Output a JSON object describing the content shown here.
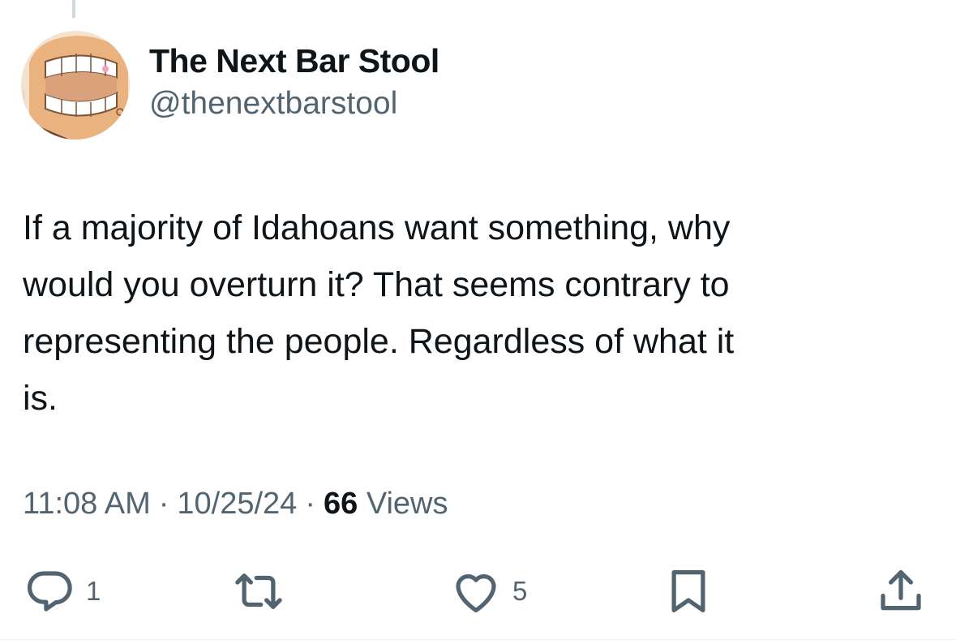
{
  "author": {
    "display_name": "The Next Bar Stool",
    "handle": "@thenextbarstool"
  },
  "tweet": {
    "text_lines": [
      "If a majority of Idahoans want something, why",
      "would you overturn it? That seems contrary to",
      "representing the people. Regardless of what it",
      "is."
    ],
    "time": "11:08 AM",
    "date": "10/25/24",
    "separator": "·",
    "views_count": "66",
    "views_label": "Views"
  },
  "actions": {
    "reply_count": "1",
    "like_count": "5",
    "icons": [
      "reply-icon",
      "retweet-icon",
      "like-icon",
      "bookmark-icon",
      "share-icon"
    ]
  },
  "colors": {
    "text": "#0f1419",
    "secondary": "#536471",
    "thread_line": "#cfd9de"
  }
}
